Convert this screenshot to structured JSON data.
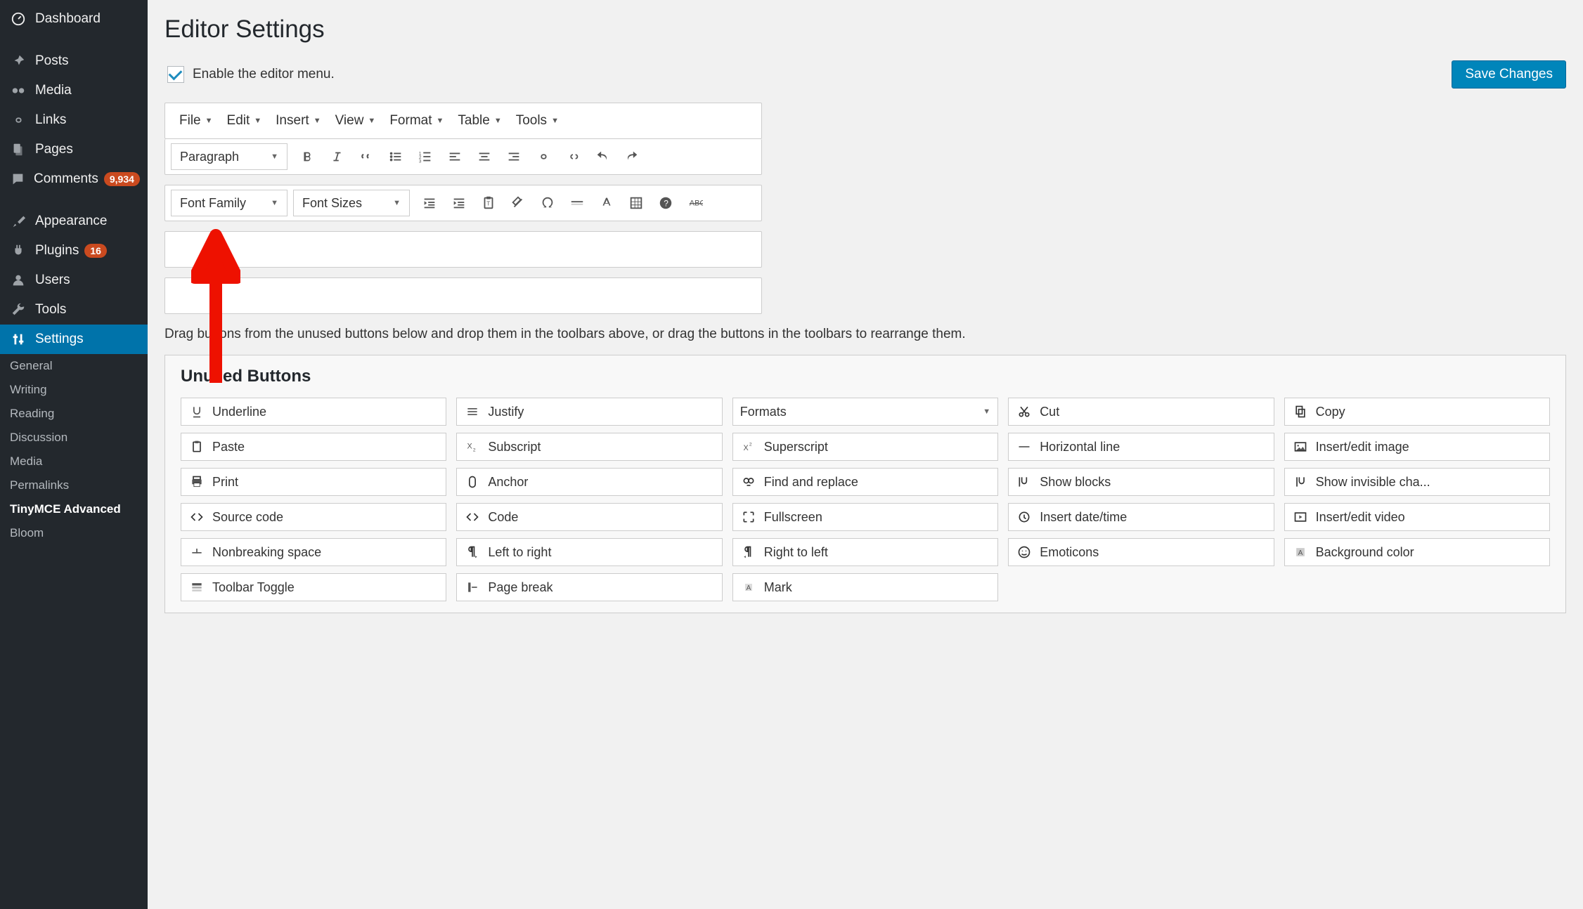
{
  "sidebar": {
    "items": [
      {
        "icon": "dashboard",
        "label": "Dashboard"
      },
      {
        "icon": "pin",
        "label": "Posts"
      },
      {
        "icon": "media",
        "label": "Media"
      },
      {
        "icon": "link",
        "label": "Links"
      },
      {
        "icon": "page",
        "label": "Pages"
      },
      {
        "icon": "comment",
        "label": "Comments",
        "badge": "9,934"
      },
      {
        "icon": "brush",
        "label": "Appearance"
      },
      {
        "icon": "plug",
        "label": "Plugins",
        "badge": "16"
      },
      {
        "icon": "user",
        "label": "Users"
      },
      {
        "icon": "tool",
        "label": "Tools"
      },
      {
        "icon": "settings",
        "label": "Settings",
        "active": true
      }
    ],
    "sub": [
      {
        "label": "General"
      },
      {
        "label": "Writing"
      },
      {
        "label": "Reading"
      },
      {
        "label": "Discussion"
      },
      {
        "label": "Media"
      },
      {
        "label": "Permalinks"
      },
      {
        "label": "TinyMCE Advanced",
        "active": true
      },
      {
        "label": "Bloom"
      }
    ]
  },
  "page": {
    "title": "Editor Settings",
    "enable_label": "Enable the editor menu.",
    "save_label": "Save Changes",
    "help_text": "Drag buttons from the unused buttons below and drop them in the toolbars above, or drag the buttons in the toolbars to rearrange them.",
    "unused_heading": "Unused Buttons"
  },
  "menubar": [
    {
      "label": "File"
    },
    {
      "label": "Edit"
    },
    {
      "label": "Insert"
    },
    {
      "label": "View"
    },
    {
      "label": "Format"
    },
    {
      "label": "Table"
    },
    {
      "label": "Tools"
    }
  ],
  "toolbar1": {
    "dd1": "Paragraph",
    "buttons": [
      "bold",
      "italic",
      "quote",
      "ul",
      "ol",
      "align-left",
      "align-center",
      "align-right",
      "link",
      "unlink",
      "undo",
      "redo"
    ]
  },
  "toolbar2": {
    "dd1": "Font Family",
    "dd2": "Font Sizes",
    "buttons": [
      "outdent",
      "indent",
      "paste-text",
      "clear",
      "omega",
      "hr",
      "textcolor",
      "table",
      "help",
      "strike"
    ]
  },
  "unused": [
    {
      "icon": "underline",
      "label": "Underline"
    },
    {
      "icon": "justify",
      "label": "Justify"
    },
    {
      "icon": "formats",
      "label": "Formats",
      "dd": true
    },
    {
      "icon": "cut",
      "label": "Cut"
    },
    {
      "icon": "copy",
      "label": "Copy"
    },
    {
      "icon": "paste",
      "label": "Paste"
    },
    {
      "icon": "subscript",
      "label": "Subscript"
    },
    {
      "icon": "superscript",
      "label": "Superscript"
    },
    {
      "icon": "hr",
      "label": "Horizontal line"
    },
    {
      "icon": "image",
      "label": "Insert/edit image"
    },
    {
      "icon": "print",
      "label": "Print"
    },
    {
      "icon": "anchor",
      "label": "Anchor"
    },
    {
      "icon": "find",
      "label": "Find and replace"
    },
    {
      "icon": "blocks",
      "label": "Show blocks"
    },
    {
      "icon": "invisible",
      "label": "Show invisible cha..."
    },
    {
      "icon": "source",
      "label": "Source code"
    },
    {
      "icon": "code",
      "label": "Code"
    },
    {
      "icon": "fullscreen",
      "label": "Fullscreen"
    },
    {
      "icon": "datetime",
      "label": "Insert date/time"
    },
    {
      "icon": "video",
      "label": "Insert/edit video"
    },
    {
      "icon": "nbsp",
      "label": "Nonbreaking space"
    },
    {
      "icon": "ltr",
      "label": "Left to right"
    },
    {
      "icon": "rtl",
      "label": "Right to left"
    },
    {
      "icon": "emoticons",
      "label": "Emoticons"
    },
    {
      "icon": "bgcolor",
      "label": "Background color"
    },
    {
      "icon": "toolbar",
      "label": "Toolbar Toggle"
    },
    {
      "icon": "pagebreak",
      "label": "Page break"
    },
    {
      "icon": "mark",
      "label": "Mark"
    }
  ]
}
